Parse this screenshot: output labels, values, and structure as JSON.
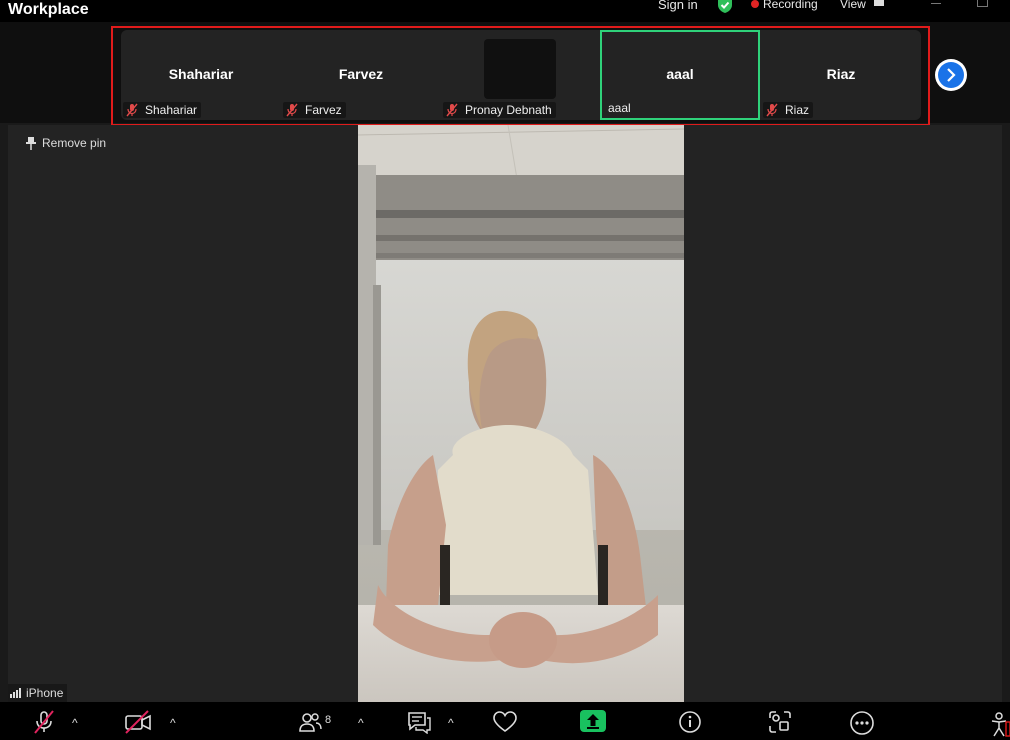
{
  "window": {
    "title": "Workplace"
  },
  "header": {
    "sign_in": "Sign in",
    "recording_label": "Recording",
    "view_label": "View"
  },
  "strip": {
    "tiles": [
      {
        "display_name": "Shahariar",
        "label": "Shahariar",
        "muted": true,
        "video": false,
        "active": false
      },
      {
        "display_name": "Farvez",
        "label": "Farvez",
        "muted": true,
        "video": false,
        "active": false
      },
      {
        "display_name": "",
        "label": "Pronay Debnath",
        "muted": true,
        "video": true,
        "active": false
      },
      {
        "display_name": "aaal",
        "label": "aaal",
        "muted": false,
        "video": false,
        "active": true
      },
      {
        "display_name": "Riaz",
        "label": "Riaz",
        "muted": true,
        "video": false,
        "active": false
      }
    ]
  },
  "main": {
    "remove_pin_label": "Remove pin",
    "device_label": "iPhone"
  },
  "toolbar": {
    "participants_count": "8"
  },
  "colors": {
    "accent_blue": "#1a73e8",
    "active_green": "#2fd27a",
    "record_red": "#e02424",
    "share_green": "#19c15f",
    "highlight_red": "#e01b1b"
  },
  "icons": [
    "shield-check-icon",
    "record-icon",
    "view-grid-icon",
    "mic-muted-icon",
    "video-off-icon",
    "participants-icon",
    "chat-icon",
    "heart-icon",
    "share-screen-icon",
    "info-icon",
    "apps-icon",
    "more-icon",
    "pin-icon",
    "signal-icon",
    "chevron-right-icon"
  ]
}
